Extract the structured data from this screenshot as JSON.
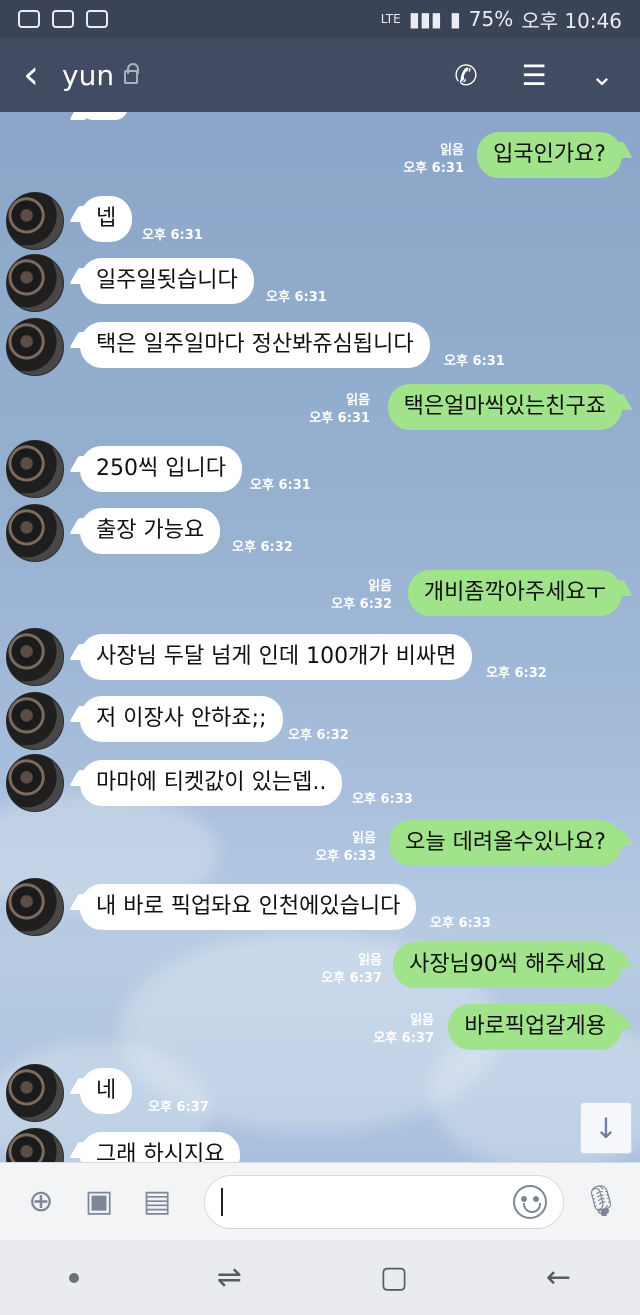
{
  "status_bar": {
    "network": "LTE",
    "battery": "75%",
    "time": "오후 10:46"
  },
  "header": {
    "title": "yun",
    "back_icon": "chevron-left-icon",
    "call_icon": "phone-icon",
    "menu_icon": "notes-icon",
    "expand_icon": "chevron-down-icon"
  },
  "messages": [
    {
      "side": "out",
      "text": "입국인가요?",
      "read": "읽음",
      "time": "오후 6:31"
    },
    {
      "side": "in",
      "text": "넵",
      "time": "오후 6:31"
    },
    {
      "side": "in",
      "text": "일주일됫습니다",
      "time": "오후 6:31"
    },
    {
      "side": "in",
      "text": "택은 일주일마다 정산봐쥬심됩니다",
      "time": "오후 6:31"
    },
    {
      "side": "out",
      "text": "택은얼마씩있는친구죠",
      "read": "읽음",
      "time": "오후 6:31"
    },
    {
      "side": "in",
      "text": "250씩 입니다",
      "time": "오후 6:31"
    },
    {
      "side": "in",
      "text": "출장 가능요",
      "time": "오후 6:32"
    },
    {
      "side": "out",
      "text": "개비좀깍아주세요ㅜ",
      "read": "읽음",
      "time": "오후 6:32"
    },
    {
      "side": "in",
      "text": "사장님 두달 넘게 인데 100개가 비싸면",
      "time": "오후 6:32"
    },
    {
      "side": "in",
      "text": "저 이장사 안하죠;;",
      "time": "오후 6:32"
    },
    {
      "side": "in",
      "text": "마마에 티켓값이 있는뎁..",
      "time": "오후 6:33"
    },
    {
      "side": "out",
      "text": "오늘 데려올수있나요?",
      "read": "읽음",
      "time": "오후 6:33"
    },
    {
      "side": "in",
      "text": "내 바로 픽업돠요 인천에있습니다",
      "time": "오후 6:33"
    },
    {
      "side": "out",
      "text": "사장님90씩 해주세요",
      "read": "읽음",
      "time": "오후 6:37"
    },
    {
      "side": "out",
      "text": "바로픽업갈게용",
      "read": "읽음",
      "time": "오후 6:37"
    },
    {
      "side": "in",
      "text": "네",
      "time": "오후 6:37"
    },
    {
      "side": "in",
      "text": "그래 하시지요",
      "time": ""
    }
  ],
  "input": {
    "placeholder": "",
    "add_icon": "plus-circle-icon",
    "camera_icon": "camera-icon",
    "gallery_icon": "image-icon",
    "emoji_icon": "emoji-icon",
    "mic_icon": "microphone-icon"
  },
  "navigation": {
    "recent_icon": "recent-apps-icon",
    "home_icon": "home-icon",
    "back_icon": "back-arrow-icon"
  }
}
